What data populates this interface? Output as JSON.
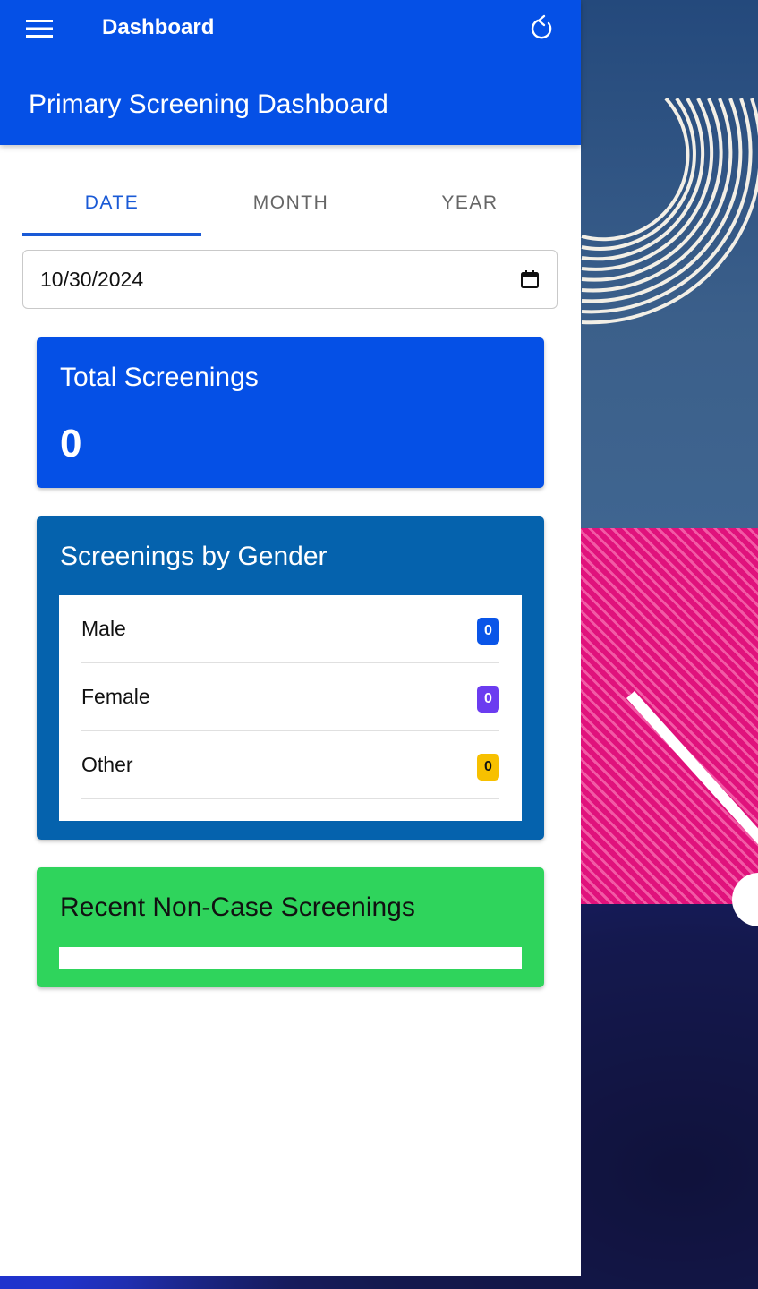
{
  "appbar": {
    "title": "Dashboard",
    "page_title": "Primary Screening Dashboard",
    "menu_icon": "menu-icon",
    "refresh_icon": "refresh-icon",
    "color": "#0550e6"
  },
  "tabs": [
    {
      "label": "DATE",
      "active": true
    },
    {
      "label": "MONTH",
      "active": false
    },
    {
      "label": "YEAR",
      "active": false
    }
  ],
  "date_filter": {
    "value": "10/30/2024",
    "icon": "calendar-icon"
  },
  "total_screenings": {
    "label": "Total Screenings",
    "value": "0",
    "color": "#0550e6"
  },
  "gender": {
    "label": "Screenings by Gender",
    "color": "#0562ad",
    "rows": [
      {
        "label": "Male",
        "count": "0",
        "badge_color": "#0a55e8",
        "text_color": "#ffffff"
      },
      {
        "label": "Female",
        "count": "0",
        "badge_color": "#6b3cf0",
        "text_color": "#ffffff"
      },
      {
        "label": "Other",
        "count": "0",
        "badge_color": "#f7c000",
        "text_color": "#111111"
      }
    ]
  },
  "recent": {
    "label": "Recent Non-Case Screenings",
    "color": "#2fd45c"
  }
}
